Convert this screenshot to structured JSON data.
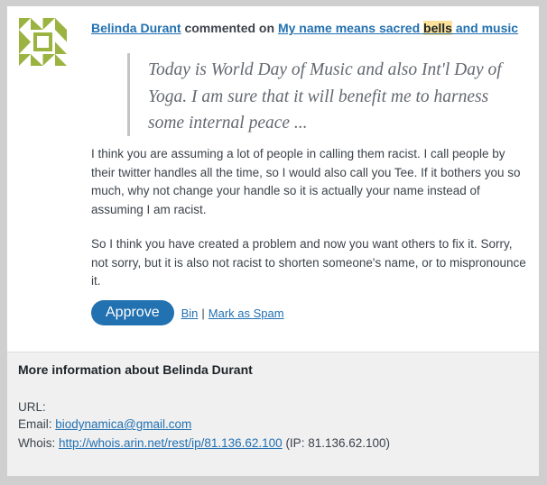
{
  "colors": {
    "accent": "#2271b1",
    "avatar": "#9bb341",
    "highlight": "#fbe19a"
  },
  "comment": {
    "author": "Belinda Durant",
    "action": " commented on ",
    "post_title_before": "My name means sacred ",
    "post_title_highlight": "bells",
    "post_title_after": " and music",
    "quote": "Today is World Day of Music and also Int'l Day of Yoga. I am sure that it will benefit me to harness some internal peace ...",
    "paragraph1": "I think you are assuming a lot of people in calling them racist. I call people by their twitter handles all the time, so I would also call you Tee. If it bothers you so much, why not change your handle so it is actually your name instead of assuming I am racist.",
    "paragraph2": "So I think you have created a problem and now you want others to fix it. Sorry, not sorry, but it is also not racist to shorten someone's name, or to mispronounce it."
  },
  "actions": {
    "approve": "Approve",
    "bin": "Bin",
    "separator": "|",
    "spam": "Mark as Spam"
  },
  "info": {
    "title": "More information about Belinda Durant",
    "url_label": "URL:",
    "email_label": "Email: ",
    "email": "biodynamica@gmail.com",
    "whois_label": "Whois: ",
    "whois_link": "http://whois.arin.net/rest/ip/81.136.62.100",
    "ip_text": " (IP: 81.136.62.100)"
  },
  "avatar_icon": "geometric-identicon"
}
